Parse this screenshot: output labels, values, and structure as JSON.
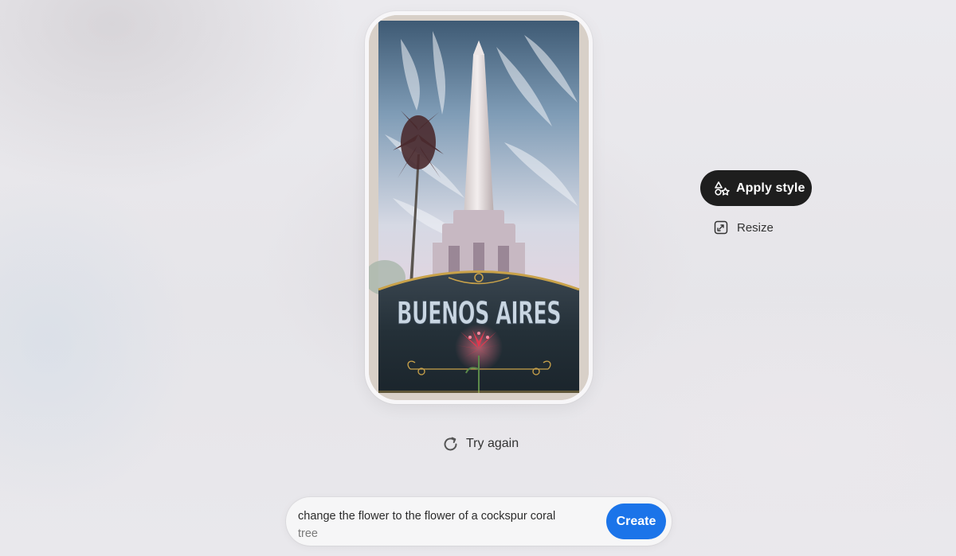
{
  "artwork": {
    "poster_title": "BUENOS AIRES"
  },
  "actions": {
    "apply_style_label": "Apply style",
    "apply_style_icon": "shapes-icon",
    "resize_label": "Resize",
    "resize_icon": "resize-icon",
    "try_again_label": "Try again",
    "try_again_icon": "refresh-icon"
  },
  "prompt": {
    "line1": "change the flower to the flower of a cockspur coral",
    "line2": "tree",
    "create_label": "Create"
  },
  "colors": {
    "apply_style_bg": "#1e1e1e",
    "create_bg": "#1b74e9",
    "poster_gold": "#c9a24a"
  }
}
